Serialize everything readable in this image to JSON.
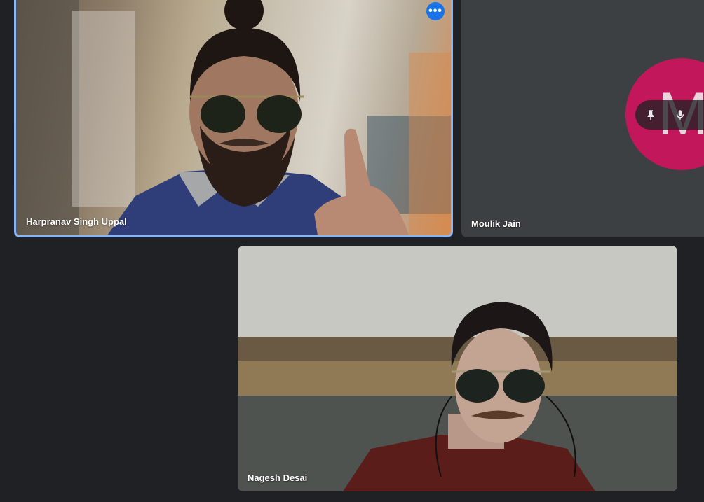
{
  "participants": [
    {
      "name": "Harpranav Singh Uppal"
    },
    {
      "name": "Moulik Jain",
      "avatar_initial": "M"
    },
    {
      "name": "Nagesh Desai"
    }
  ],
  "controls": {
    "more_options_label": "•••"
  },
  "icons": {
    "more_options": "more-horizontal-icon",
    "pin": "pin-icon",
    "mic": "mic-icon"
  },
  "colors": {
    "active_border": "#8ab4f8",
    "more_button": "#1a73e8",
    "avatar_bg": "#c2185b",
    "background": "#202124",
    "tile_bg": "#3c4043"
  }
}
